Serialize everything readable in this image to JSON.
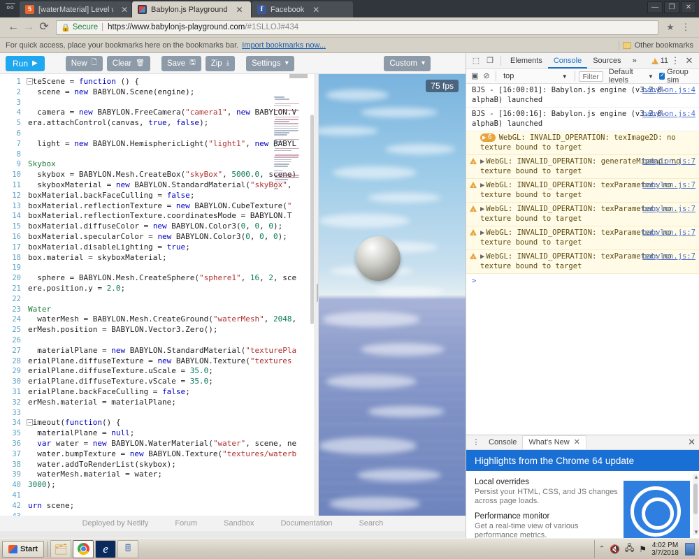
{
  "browser": {
    "tabs": [
      {
        "title": "[waterMaterial] Level wate",
        "favicon": "html5-icon",
        "active": false
      },
      {
        "title": "Babylon.js Playground",
        "favicon": "babylonjs-icon",
        "active": true
      },
      {
        "title": "Facebook",
        "favicon": "facebook-icon",
        "active": false
      }
    ],
    "window_controls": {
      "minimize": "—",
      "maximize": "❐",
      "close": "✕"
    },
    "nav": {
      "back": "←",
      "forward": "→",
      "reload": "⟳"
    },
    "omnibox": {
      "lock_icon": "lock-icon",
      "secure_label": "Secure",
      "url_main": "https://www.babylonjs-playground.com",
      "url_dim": "/#1SLLOJ#434",
      "star_icon": "★",
      "menu_icon": "⋮"
    },
    "bookmarks_bar": {
      "hint": "For quick access, place your bookmarks here on the bookmarks bar.",
      "import_link": "Import bookmarks now...",
      "other_bookmarks": "Other bookmarks"
    }
  },
  "playground": {
    "toolbar": {
      "run": "Run",
      "run_icon": "▶",
      "new": "New",
      "new_icon": "🗋",
      "clear": "Clear",
      "clear_icon": "🗑",
      "save": "Save",
      "save_icon": "🖫",
      "zip": "Zip",
      "zip_icon": "⤓",
      "settings": "Settings",
      "settings_icon": "▾",
      "custom": "Custom",
      "custom_icon": "▾"
    },
    "footer": {
      "deployed": "Deployed by Netlify",
      "forum": "Forum",
      "sandbox": "Sandbox",
      "documentation": "Documentation",
      "search": "Search"
    },
    "canvas": {
      "fps": "75 fps"
    },
    "code_lines": [
      {
        "n": 1,
        "fold": true,
        "html": "ateScene = <span class='k'>function</span> () {"
      },
      {
        "n": 2,
        "fold": false,
        "html": "  scene = <span class='k'>new</span> BABYLON.Scene(engine);"
      },
      {
        "n": 3,
        "fold": false,
        "html": ""
      },
      {
        "n": 4,
        "fold": false,
        "html": "  camera = <span class='k'>new</span> BABYLON.FreeCamera(<span class='s'>\"camera1\"</span>, <span class='k'>new</span> BABYLON.V"
      },
      {
        "n": 5,
        "fold": false,
        "html": "era.attachControl(canvas, <span class='k'>true</span>, <span class='k'>false</span>);"
      },
      {
        "n": 6,
        "fold": false,
        "html": ""
      },
      {
        "n": 7,
        "fold": false,
        "html": "  light = <span class='k'>new</span> BABYLON.HemisphericLight(<span class='s'>\"light1\"</span>, <span class='k'>new</span> BABYL"
      },
      {
        "n": 8,
        "fold": false,
        "html": ""
      },
      {
        "n": 9,
        "fold": false,
        "html": "<span class='c'>Skybox</span>"
      },
      {
        "n": 10,
        "fold": false,
        "html": "  skybox = BABYLON.Mesh.CreateBox(<span class='s'>\"skyBox\"</span>, <span class='n'>5000.0</span>, scene)"
      },
      {
        "n": 11,
        "fold": false,
        "html": "  skyboxMaterial = <span class='k'>new</span> BABYLON.StandardMaterial(<span class='s'>\"skyBox\"</span>,"
      },
      {
        "n": 12,
        "fold": false,
        "html": "boxMaterial.backFaceCulling = <span class='k'>false</span>;"
      },
      {
        "n": 13,
        "fold": false,
        "html": "boxMaterial.reflectionTexture = <span class='k'>new</span> BABYLON.CubeTexture(<span class='s'>\"</span>"
      },
      {
        "n": 14,
        "fold": false,
        "html": "boxMaterial.reflectionTexture.coordinatesMode = BABYLON.T"
      },
      {
        "n": 15,
        "fold": false,
        "html": "boxMaterial.diffuseColor = <span class='k'>new</span> BABYLON.Color3(<span class='n'>0</span>, <span class='n'>0</span>, <span class='n'>0</span>);"
      },
      {
        "n": 16,
        "fold": false,
        "html": "boxMaterial.specularColor = <span class='k'>new</span> BABYLON.Color3(<span class='n'>0</span>, <span class='n'>0</span>, <span class='n'>0</span>);"
      },
      {
        "n": 17,
        "fold": false,
        "html": "boxMaterial.disableLighting = <span class='k'>true</span>;"
      },
      {
        "n": 18,
        "fold": false,
        "html": "box.material = skyboxMaterial;"
      },
      {
        "n": 19,
        "fold": false,
        "html": ""
      },
      {
        "n": 20,
        "fold": false,
        "html": "  sphere = BABYLON.Mesh.CreateSphere(<span class='s'>\"sphere1\"</span>, <span class='n'>16</span>, <span class='n'>2</span>, sce"
      },
      {
        "n": 21,
        "fold": false,
        "html": "ere.position.y = <span class='n'>2.0</span>;"
      },
      {
        "n": 22,
        "fold": false,
        "html": ""
      },
      {
        "n": 23,
        "fold": false,
        "html": "<span class='c'>Water</span>"
      },
      {
        "n": 24,
        "fold": false,
        "html": "  waterMesh = BABYLON.Mesh.CreateGround(<span class='s'>\"waterMesh\"</span>, <span class='n'>2048</span>,"
      },
      {
        "n": 25,
        "fold": false,
        "html": "erMesh.position = BABYLON.Vector3.Zero();"
      },
      {
        "n": 26,
        "fold": false,
        "html": ""
      },
      {
        "n": 27,
        "fold": false,
        "html": "  materialPlane = <span class='k'>new</span> BABYLON.StandardMaterial(<span class='s'>\"texturePla</span>"
      },
      {
        "n": 28,
        "fold": false,
        "html": "erialPlane.diffuseTexture = <span class='k'>new</span> BABYLON.Texture(<span class='s'>\"textures</span>"
      },
      {
        "n": 29,
        "fold": false,
        "html": "erialPlane.diffuseTexture.uScale = <span class='n'>35.0</span>;"
      },
      {
        "n": 30,
        "fold": false,
        "html": "erialPlane.diffuseTexture.vScale = <span class='n'>35.0</span>;"
      },
      {
        "n": 31,
        "fold": false,
        "html": "erialPlane.backFaceCulling = <span class='k'>false</span>;"
      },
      {
        "n": 32,
        "fold": false,
        "html": "erMesh.material = materialPlane;"
      },
      {
        "n": 33,
        "fold": false,
        "html": ""
      },
      {
        "n": 34,
        "fold": true,
        "html": "Timeout(<span class='k'>function</span>() {"
      },
      {
        "n": 35,
        "fold": false,
        "html": "  materialPlane = <span class='k'>null</span>;"
      },
      {
        "n": 36,
        "fold": false,
        "html": "  <span class='k'>var</span> water = <span class='k'>new</span> BABYLON.WaterMaterial(<span class='s'>\"water\"</span>, scene, ne"
      },
      {
        "n": 37,
        "fold": false,
        "html": "  water.bumpTexture = <span class='k'>new</span> BABYLON.Texture(<span class='s'>\"textures/waterb</span>"
      },
      {
        "n": 38,
        "fold": false,
        "html": "  water.addToRenderList(skybox);"
      },
      {
        "n": 39,
        "fold": false,
        "html": "  waterMesh.material = water;"
      },
      {
        "n": 40,
        "fold": false,
        "html": "<span class='n'>3000</span>);"
      },
      {
        "n": 41,
        "fold": false,
        "html": ""
      },
      {
        "n": 42,
        "fold": false,
        "html": "<span class='k'>urn</span> scene;"
      },
      {
        "n": 43,
        "fold": false,
        "html": ""
      }
    ]
  },
  "devtools": {
    "toolbar": {
      "inspect_icon": "inspect-icon",
      "device_icon": "device-toolbar-icon",
      "tabs": [
        {
          "label": "Elements",
          "selected": false
        },
        {
          "label": "Console",
          "selected": true
        },
        {
          "label": "Sources",
          "selected": false
        }
      ],
      "more_tabs": "»",
      "warning_count": "11",
      "menu_icon": "⋮",
      "close_icon": "✕"
    },
    "filter_bar": {
      "clear_icon": "clear-console-icon",
      "sidebar_icon": "console-sidebar-icon",
      "context": "top",
      "context_caret": "▼",
      "filter_placeholder": "Filter",
      "levels": "Default levels",
      "levels_caret": "▼",
      "group_similar": "Group sim"
    },
    "messages": [
      {
        "type": "log",
        "badge": null,
        "text": "BJS - [16:00:01]: Babylon.js engine (v3.2.0-alphaB) launched",
        "source": "babylon.js:4",
        "arrow": false
      },
      {
        "type": "log",
        "badge": null,
        "text": "BJS - [16:00:16]: Babylon.js engine (v3.2.0-alphaB) launched",
        "source": "babylon.js:4",
        "arrow": false
      },
      {
        "type": "warn",
        "badge": "6",
        "text": "WebGL: INVALID_OPERATION: texImage2D: no texture bound to target",
        "source": "",
        "arrow": false
      },
      {
        "type": "warn",
        "badge": null,
        "text": "WebGL: INVALID_OPERATION: generateMipmap: no texture bound to target",
        "source": "babylon.js:7",
        "arrow": true
      },
      {
        "type": "warn",
        "badge": null,
        "text": "WebGL: INVALID_OPERATION: texParameter: no texture bound to target",
        "source": "babylon.js:7",
        "arrow": true
      },
      {
        "type": "warn",
        "badge": null,
        "text": "WebGL: INVALID_OPERATION: texParameter: no texture bound to target",
        "source": "babylon.js:7",
        "arrow": true
      },
      {
        "type": "warn",
        "badge": null,
        "text": "WebGL: INVALID_OPERATION: texParameter: no texture bound to target",
        "source": "babylon.js:7",
        "arrow": true
      },
      {
        "type": "warn",
        "badge": null,
        "text": "WebGL: INVALID_OPERATION: texParameter: no texture bound to target",
        "source": "babylon.js:7",
        "arrow": true
      }
    ],
    "prompt": ">",
    "drawer": {
      "menu_icon": "⋮",
      "tabs": [
        {
          "label": "Console",
          "selected": false,
          "closable": false
        },
        {
          "label": "What's New",
          "selected": true,
          "closable": true
        }
      ],
      "close_icon": "✕",
      "header": "Highlights from the Chrome 64 update",
      "items": [
        {
          "title": "Local overrides",
          "body": "Persist your HTML, CSS, and JS changes across page loads."
        },
        {
          "title": "Performance monitor",
          "body": "Get a real-time view of various performance metrics."
        }
      ]
    }
  },
  "taskbar": {
    "start_label": "Start",
    "items": [
      {
        "name": "file-explorer-icon",
        "glyph": "🗂",
        "active": false
      },
      {
        "name": "chrome-icon",
        "glyph": "◉",
        "active": true
      },
      {
        "name": "internet-explorer-icon",
        "glyph": "e",
        "active": false
      },
      {
        "name": "calculator-icon",
        "glyph": "🖩",
        "active": false
      }
    ],
    "tray": {
      "show_hidden": "⌃",
      "volume_icon": "volume-muted-icon",
      "network_icon": "network-icon",
      "action_icon": "flag-icon",
      "time": "4:02 PM",
      "date": "3/7/2018"
    }
  },
  "colors": {
    "accent_blue": "#1a6fd4",
    "run_blue": "#1fa7f0",
    "button_gray": "#8d9aa8",
    "warn_yellow": "#e8a33d",
    "chrome_frame": "#31363c"
  }
}
